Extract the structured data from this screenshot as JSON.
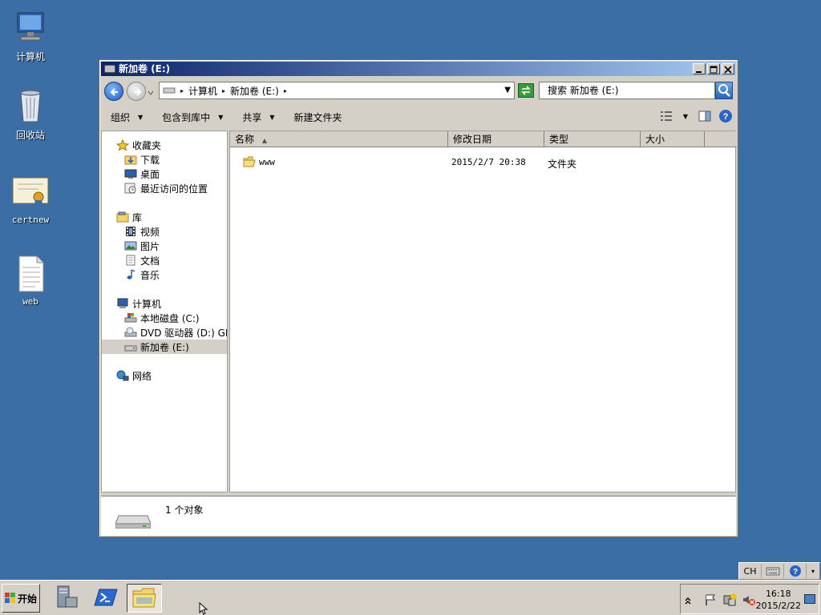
{
  "desktop": {
    "icons": [
      {
        "label": "计算机",
        "icon": "computer-icon"
      },
      {
        "label": "回收站",
        "icon": "recycle-bin-icon"
      },
      {
        "label": "certnew",
        "icon": "certificate-icon"
      },
      {
        "label": "web",
        "icon": "text-file-icon"
      }
    ]
  },
  "window": {
    "title": "新加卷 (E:)",
    "address": {
      "segments": [
        "计算机",
        "新加卷 (E:)"
      ]
    },
    "search": {
      "placeholder": "搜索 新加卷 (E:)"
    },
    "toolbar": {
      "organize": "组织",
      "include_library": "包含到库中",
      "share": "共享",
      "new_folder": "新建文件夹"
    },
    "nav": {
      "favorites": "收藏夹",
      "downloads": "下载",
      "desktop": "桌面",
      "recent": "最近访问的位置",
      "libraries": "库",
      "videos": "视频",
      "pictures": "图片",
      "documents": "文档",
      "music": "音乐",
      "computer": "计算机",
      "local_disk": "本地磁盘 (C:)",
      "dvd": "DVD 驱动器 (D:) GF",
      "new_volume": "新加卷 (E:)",
      "network": "网络"
    },
    "columns": {
      "name": "名称",
      "modified": "修改日期",
      "type": "类型",
      "size": "大小"
    },
    "files": [
      {
        "name": "www",
        "modified": "2015/2/7 20:38",
        "type": "文件夹",
        "size": ""
      }
    ],
    "status": {
      "count": "1 个对象"
    }
  },
  "taskbar": {
    "start": "开始",
    "language": "CH",
    "clock_time": "16:18",
    "clock_date": "2015/2/22"
  }
}
